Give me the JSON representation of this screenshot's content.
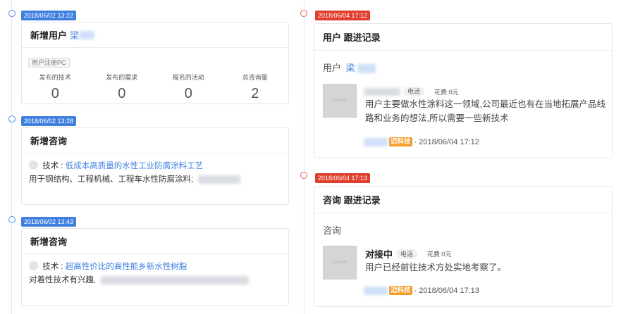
{
  "left_timeline": [
    {
      "date": "2018/06/02 13:22",
      "title": "新增用户",
      "user_name": "梁",
      "source_tag": "用户注册PC",
      "stats": [
        {
          "label": "发布的技术",
          "value": "0"
        },
        {
          "label": "发布的需求",
          "value": "0"
        },
        {
          "label": "报名的活动",
          "value": "0"
        },
        {
          "label": "总咨询量",
          "value": "2"
        }
      ]
    },
    {
      "date": "2018/06/02 13:28",
      "title": "新增咨询",
      "tech_prefix": "技术 :",
      "tech_link": "低成本高质量的水性工业防腐涂料工艺",
      "content": "用于钢结构、工程机械、工程车水性防腐涂料;"
    },
    {
      "date": "2018/06/02 13:43",
      "title": "新增咨询",
      "tech_prefix": "技术 :",
      "tech_link": "超高性价比的高性能乡新水性树脂",
      "content": "对着性技术有兴趣,"
    }
  ],
  "right_timeline": [
    {
      "date": "2018/06/04 17:12",
      "title": "用户 跟进记录",
      "subject_label": "用户",
      "subject_name": "梁",
      "thumb_label": "120×120",
      "contact_tag": "电话",
      "fee": "花费:0元",
      "text": "用户主要做水性涂料这一领域,公司最近也有在当地拓展产品线路和业务的想法,所以需要一些新技术",
      "brand": "迈科技",
      "timestamp": "· 2018/06/04 17:12"
    },
    {
      "date": "2018/06/04 17:13",
      "title": "咨询 跟进记录",
      "subject_label": "咨询",
      "status": "对接中",
      "thumb_label": "120×120",
      "contact_tag": "电话",
      "fee": "花费:0元",
      "text": "用户已经前往技术方处实地考察了。",
      "brand": "迈科技",
      "timestamp": "· 2018/06/04 17:13"
    }
  ],
  "colors": {
    "blue_badge": "#3f7fe0",
    "red_badge": "#e13d2c",
    "brand_badge": "#f59a23"
  }
}
